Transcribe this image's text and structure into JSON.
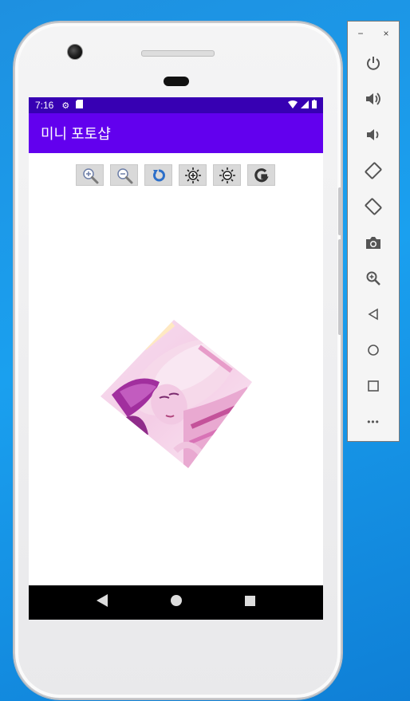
{
  "status_bar": {
    "time": "7:16"
  },
  "app_bar": {
    "title": "미니 포토샵"
  },
  "toolbar": {
    "buttons": [
      {
        "name": "zoom-in",
        "icon": "zoom-in-icon"
      },
      {
        "name": "zoom-out",
        "icon": "zoom-out-icon"
      },
      {
        "name": "rotate",
        "icon": "rotate-icon"
      },
      {
        "name": "brightness-up",
        "icon": "brightness-up-icon"
      },
      {
        "name": "brightness-down",
        "icon": "brightness-down-icon"
      },
      {
        "name": "grayscale",
        "icon": "grayscale-icon"
      }
    ]
  },
  "nav_bar": {
    "buttons": [
      "back",
      "home",
      "recents"
    ]
  },
  "emulator_panel": {
    "window_controls": {
      "minimize": "−",
      "close": "×"
    },
    "buttons": [
      "power",
      "volume-up",
      "volume-down",
      "rotate-left",
      "rotate-right",
      "screenshot",
      "zoom",
      "back",
      "home",
      "overview",
      "more"
    ],
    "more_label": "•••"
  },
  "colors": {
    "status_bar": "#3700b3",
    "app_bar": "#6200ee",
    "desktop": "#1a96e8"
  }
}
